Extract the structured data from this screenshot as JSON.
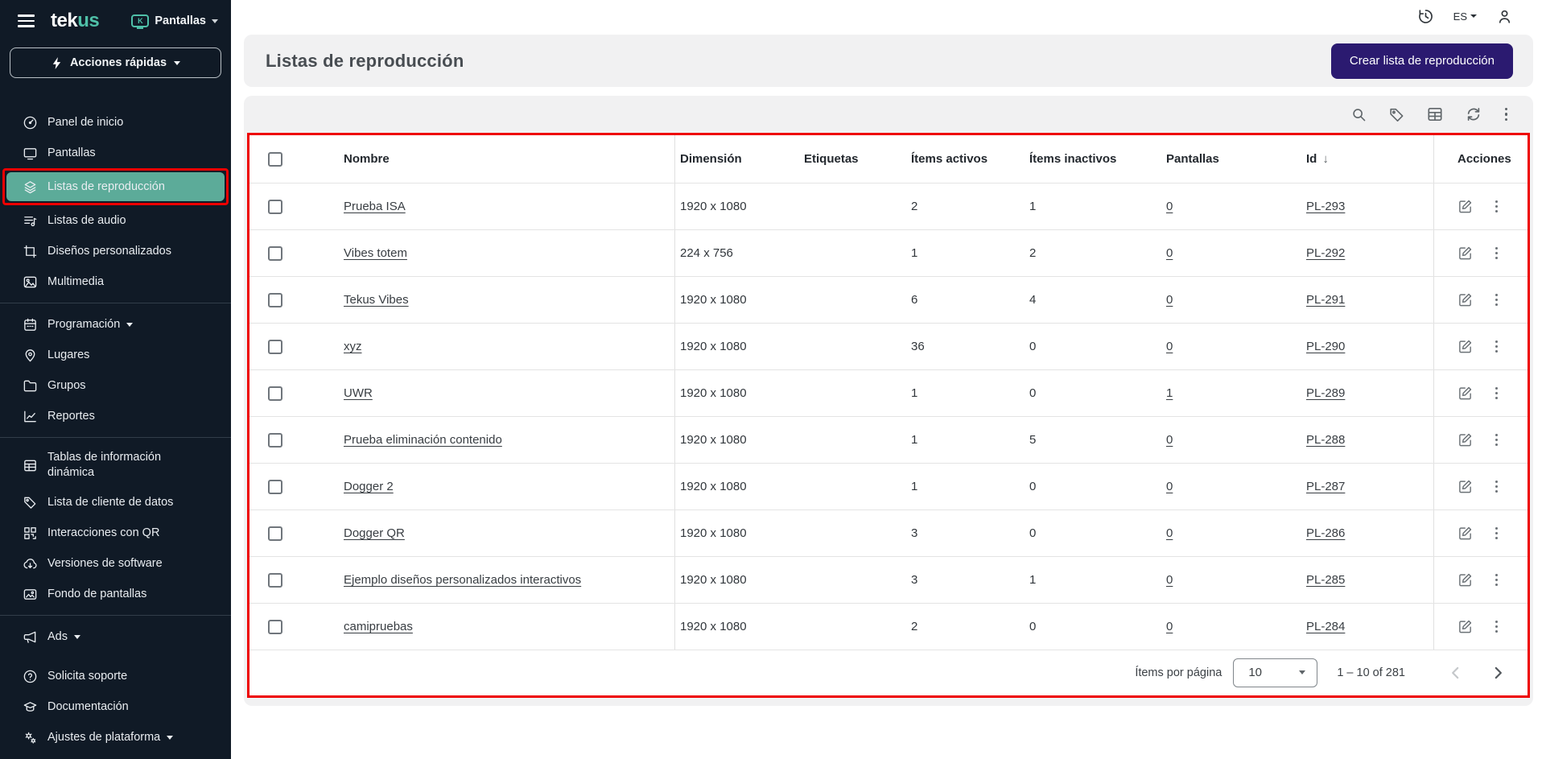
{
  "brand": {
    "logo_tek": "tek",
    "logo_us": "us",
    "context_label": "Pantallas",
    "context_icon_letter": "K"
  },
  "topbar": {
    "language": "ES"
  },
  "sidebar": {
    "quick_actions": "Acciones rápidas",
    "items": [
      {
        "label": "Panel de inicio"
      },
      {
        "label": "Pantallas"
      },
      {
        "label": "Listas de reproducción",
        "active": true
      },
      {
        "label": "Listas de audio"
      },
      {
        "label": "Diseños personalizados"
      },
      {
        "label": "Multimedia"
      },
      {
        "label": "Programación"
      },
      {
        "label": "Lugares"
      },
      {
        "label": "Grupos"
      },
      {
        "label": "Reportes"
      },
      {
        "label": "Tablas de información dinámica"
      },
      {
        "label": "Lista de cliente de datos"
      },
      {
        "label": "Interacciones con QR"
      },
      {
        "label": "Versiones de software"
      },
      {
        "label": "Fondo de pantallas"
      },
      {
        "label": "Ads"
      }
    ],
    "footer_items": [
      {
        "label": "Solicita soporte"
      },
      {
        "label": "Documentación"
      },
      {
        "label": "Ajustes de plataforma"
      }
    ]
  },
  "page": {
    "title": "Listas de reproducción",
    "create_button": "Crear lista de reproducción"
  },
  "table": {
    "headers": {
      "nombre": "Nombre",
      "dimension": "Dimensión",
      "etiquetas": "Etiquetas",
      "items_activos": "Ítems activos",
      "items_inactivos": "Ítems inactivos",
      "pantallas": "Pantallas",
      "id": "Id",
      "acciones": "Acciones",
      "sort_arrow": "↓"
    },
    "rows": [
      {
        "name": "Prueba ISA",
        "dimension": "1920 x 1080",
        "tags": "",
        "active": "2",
        "inactive": "1",
        "screens": "0",
        "id": "PL-293"
      },
      {
        "name": "Vibes totem",
        "dimension": "224 x 756",
        "tags": "",
        "active": "1",
        "inactive": "2",
        "screens": "0",
        "id": "PL-292"
      },
      {
        "name": "Tekus Vibes",
        "dimension": "1920 x 1080",
        "tags": "",
        "active": "6",
        "inactive": "4",
        "screens": "0",
        "id": "PL-291"
      },
      {
        "name": "xyz",
        "dimension": "1920 x 1080",
        "tags": "",
        "active": "36",
        "inactive": "0",
        "screens": "0",
        "id": "PL-290"
      },
      {
        "name": "UWR",
        "dimension": "1920 x 1080",
        "tags": "",
        "active": "1",
        "inactive": "0",
        "screens": "1",
        "id": "PL-289"
      },
      {
        "name": "Prueba eliminación contenido",
        "dimension": "1920 x 1080",
        "tags": "",
        "active": "1",
        "inactive": "5",
        "screens": "0",
        "id": "PL-288"
      },
      {
        "name": "Dogger 2",
        "dimension": "1920 x 1080",
        "tags": "",
        "active": "1",
        "inactive": "0",
        "screens": "0",
        "id": "PL-287"
      },
      {
        "name": "Dogger QR",
        "dimension": "1920 x 1080",
        "tags": "",
        "active": "3",
        "inactive": "0",
        "screens": "0",
        "id": "PL-286"
      },
      {
        "name": "Ejemplo diseños personalizados interactivos",
        "dimension": "1920 x 1080",
        "tags": "",
        "active": "3",
        "inactive": "1",
        "screens": "0",
        "id": "PL-285"
      },
      {
        "name": "camipruebas",
        "dimension": "1920 x 1080",
        "tags": "",
        "active": "2",
        "inactive": "0",
        "screens": "0",
        "id": "PL-284"
      }
    ],
    "pagination": {
      "label": "Ítems por página",
      "page_size": "10",
      "range": "1 – 10 of 281"
    }
  },
  "colors": {
    "accent_teal": "#5cab99",
    "brand_teal": "#4fc0a8",
    "primary_button": "#2b1a70",
    "annotation_red": "#ee0000",
    "sidebar_bg": "#101a26"
  }
}
